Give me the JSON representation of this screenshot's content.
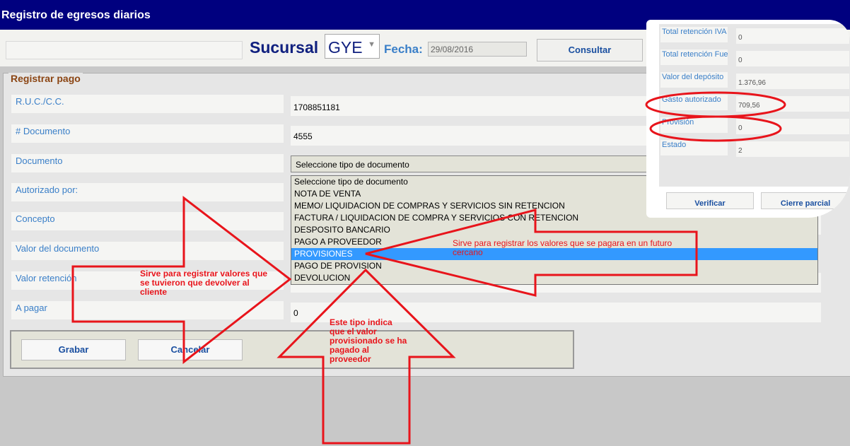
{
  "window": {
    "title": "Registro de egresos diarios"
  },
  "header": {
    "sucursal_label": "Sucursal",
    "sucursal_value": "GYE",
    "fecha_label": "Fecha:",
    "fecha_value": "29/08/2016",
    "consultar_label": "Consultar"
  },
  "form": {
    "legend": "Registrar pago",
    "ruc_label": "R.U.C./C.C.",
    "ruc_value": "1708851181",
    "documento_num_label": "# Documento",
    "documento_num_value": "4555",
    "documento_label": "Documento",
    "documento_value": "Seleccione tipo de documento",
    "autorizado_label": "Autorizado por:",
    "concepto_label": "Concepto",
    "valor_documento_label": "Valor del documento",
    "valor_retencion_label": "Valor retención",
    "a_pagar_label": "A pagar",
    "a_pagar_value": "0"
  },
  "dropdown_options": [
    "Seleccione tipo de documento",
    "NOTA DE VENTA",
    "MEMO/ LIQUIDACION DE COMPRAS Y SERVICIOS SIN RETENCION",
    "FACTURA / LIQUIDACION DE COMPRA Y SERVICIOS CON RETENCION",
    "DESPOSITO BANCARIO",
    "PAGO A PROVEEDOR",
    "PROVISIONES",
    "PAGO DE PROVISION",
    "DEVOLUCION"
  ],
  "dropdown_selected_index": 6,
  "buttons": {
    "grabar": "Grabar",
    "cancelar": "Cancelar"
  },
  "popup": {
    "rows": [
      {
        "label": "Total retención IVA",
        "value": "0"
      },
      {
        "label": "Total retención Fuen",
        "value": "0"
      },
      {
        "label": "Valor del depósito",
        "value": "1.376,96"
      },
      {
        "label": "Gasto autorizado",
        "value": "709,56"
      },
      {
        "label": "Provisión",
        "value": "0"
      },
      {
        "label": "Estado",
        "value": "2"
      }
    ],
    "verificar_label": "Verificar",
    "cierre_label": "Cierre parcial"
  },
  "annotations": {
    "devolucion": "Sirve para registrar valores que se tuvieron que devolver al cliente",
    "provisiones": "Sirve para registrar los valores que se pagara en un futuro cercano",
    "pago_provision": "Este tipo indica que el valor provisionado se ha pagado al proveedor"
  },
  "colors": {
    "titlebar": "#00007f",
    "annotation": "#e8141b",
    "selected": "#3399ff"
  }
}
